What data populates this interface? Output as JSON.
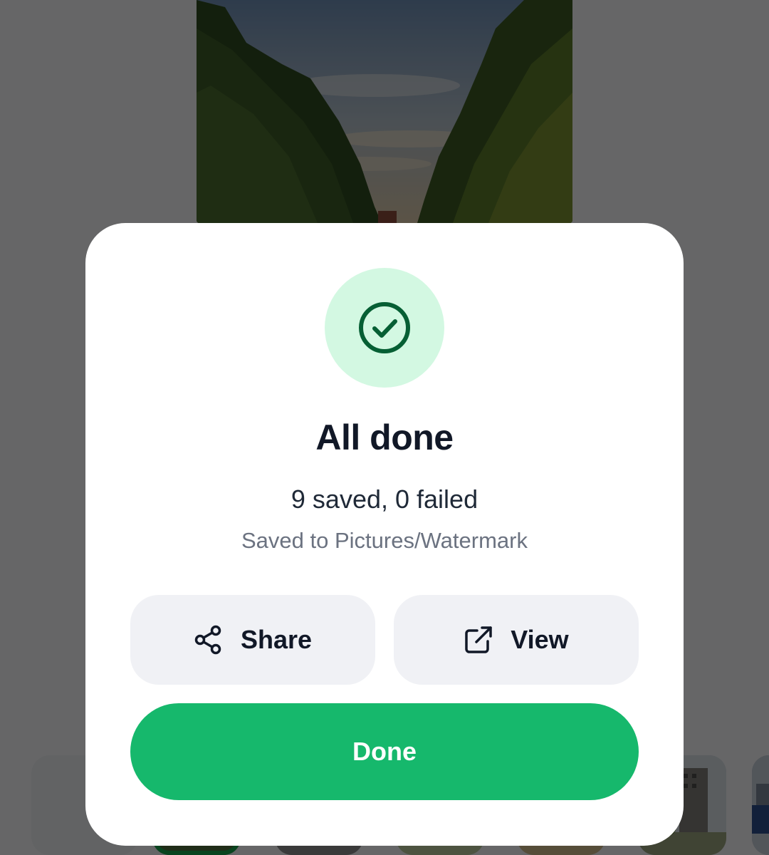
{
  "theme": {
    "accent": "#16b86c",
    "success_circle_bg": "#d3f8e2",
    "success_icon": "#065f34",
    "secondary_button_bg": "#f0f1f5",
    "scrim": "rgba(0,0,0,0.58)"
  },
  "background": {
    "preview_icon": "photo-preview",
    "add_icon": "plus-icon",
    "thumbnails_visible": 7
  },
  "dialog": {
    "icon": "check-circle-icon",
    "title": "All done",
    "summary": "9 saved, 0 failed",
    "save_path": "Saved to Pictures/Watermark",
    "share_label": "Share",
    "share_icon": "share-icon",
    "view_label": "View",
    "view_icon": "external-link-icon",
    "done_label": "Done"
  }
}
